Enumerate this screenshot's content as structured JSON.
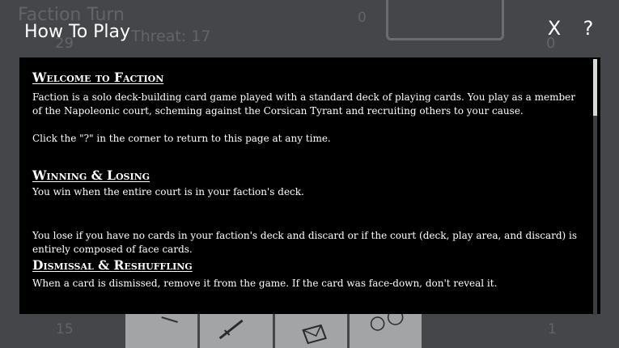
{
  "background": {
    "title": "Faction Turn",
    "threat": "Threat: 17",
    "counter_top_left": "29",
    "counter_top_center": "0",
    "counter_top_right": "0",
    "counter_bottom_left": "15",
    "counter_bottom_right": "1"
  },
  "overlay": {
    "title": "How To Play",
    "close_label": "X",
    "help_label": "?"
  },
  "sections": {
    "welcome": {
      "heading": "Welcome to Faction",
      "p1": "Faction is a solo deck-building card game played with a standard deck of playing cards. You play as a member of the Napoleonic court, scheming against the Corsican Tyrant and recruiting others to your cause.",
      "p2": "Click the \"?\" in the corner to return to this page at any time."
    },
    "winning": {
      "heading": "Winning & Losing",
      "p1": "You win when the entire court is in your faction's deck.",
      "p2": "You lose if you have no cards in your faction's deck and discard or if the court (deck, play area, and discard) is entirely composed of face cards."
    },
    "dismissal": {
      "heading": "Dismissal & Reshuffling",
      "p1": "When a card is dismissed, remove it from the game. If the card was face-down, don't reveal it."
    }
  },
  "colors": {
    "backdrop": "#454649",
    "panel": "#000000",
    "text": "#ffffff"
  }
}
